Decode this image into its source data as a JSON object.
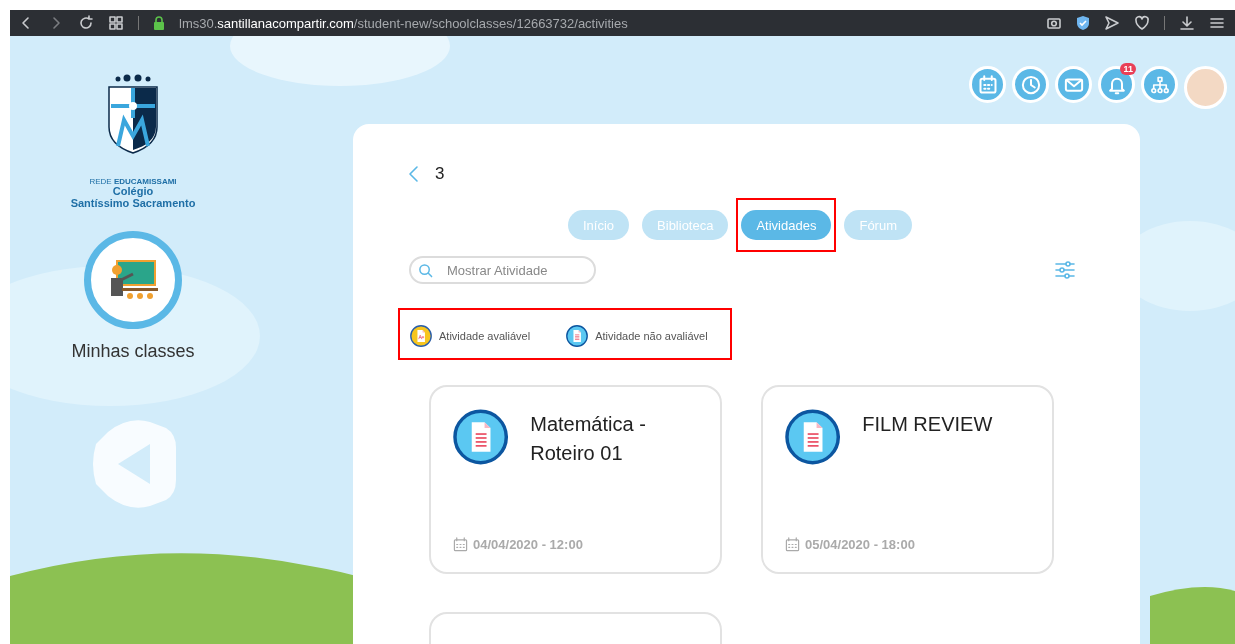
{
  "browser": {
    "url": "lms30.**santillanacompartir.com**/student-new/schoolclasses/12663732/activities"
  },
  "header": {
    "notifications_badge": "11"
  },
  "school": {
    "network": "REDE **EDUCAMISSAMI**",
    "name_line_1": "Colégio",
    "name_line_2": "Santíssimo Sacramento"
  },
  "sidebar": {
    "label": "Minhas classes"
  },
  "class": {
    "title": "3"
  },
  "tabs": [
    {
      "label": "Início",
      "selected": false,
      "highlighted": false
    },
    {
      "label": "Biblioteca",
      "selected": false,
      "highlighted": false
    },
    {
      "label": "Atividades",
      "selected": true,
      "highlighted": true
    },
    {
      "label": "Fórum",
      "selected": false,
      "highlighted": false
    }
  ],
  "search": {
    "placeholder": "Mostrar Atividade"
  },
  "legend": {
    "highlighted": true,
    "items": [
      {
        "kind": "graded",
        "label": "Atividade avaliável"
      },
      {
        "kind": "ungraded",
        "label": "Atividade não avaliável"
      }
    ]
  },
  "activities": [
    {
      "kind": "ungraded",
      "title": "Matemática - Roteiro 01",
      "date": "04/04/2020 - 12:00"
    },
    {
      "kind": "ungraded",
      "title": "FILM REVIEW",
      "date": "05/04/2020 - 18:00"
    }
  ]
}
